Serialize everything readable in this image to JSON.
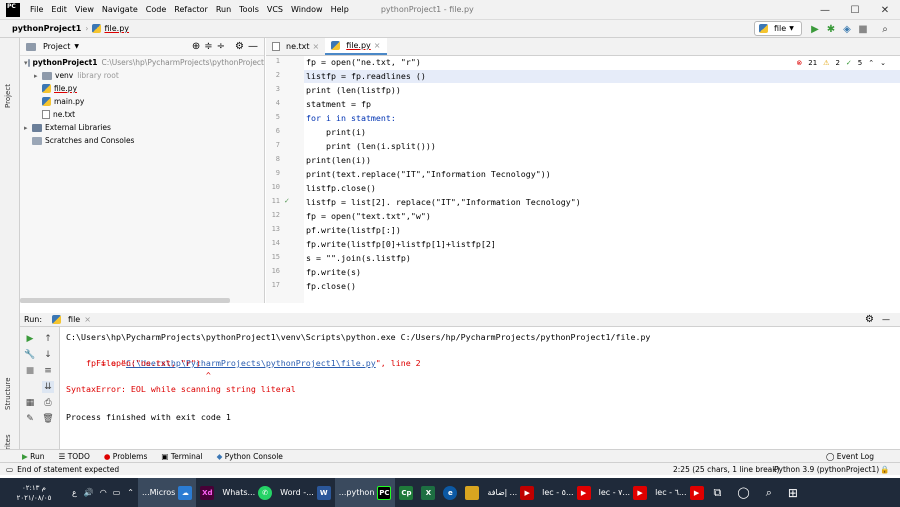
{
  "menubar": {
    "logo": "PC",
    "items": [
      "File",
      "Edit",
      "View",
      "Navigate",
      "Code",
      "Refactor",
      "Run",
      "Tools",
      "VCS",
      "Window",
      "Help"
    ],
    "title": "pythonProject1 - file.py"
  },
  "navbar": {
    "project": "pythonProject1",
    "file": "file.py",
    "run_config": "file"
  },
  "stripe": {
    "project": "Project",
    "structure": "Structure",
    "favorites": "Favorites"
  },
  "project_panel": {
    "title": "Project",
    "root": "pythonProject1",
    "root_path": "C:\\Users\\hp\\PycharmProjects\\pythonProject",
    "venv": "venv",
    "venv_note": "library root",
    "files": [
      "file.py",
      "main.py",
      "ne.txt"
    ],
    "external": "External Libraries",
    "scratches": "Scratches and Consoles"
  },
  "tabs": [
    {
      "label": "ne.txt"
    },
    {
      "label": "file.py"
    }
  ],
  "inspections": {
    "errors": "21",
    "warnings": "2",
    "ok": "5"
  },
  "code_lines": [
    "fp = open(\"ne.txt, \"r\")",
    "listfp = fp.readlines ()",
    "print (len(listfp))",
    "statment = fp",
    "for i in statment:",
    "    print(i)",
    "    print (len(i.split()))",
    "print(len(i))",
    "print(text.replace(\"IT\",\"Information Tecnology\"))",
    "listfp.close()",
    "listfp = list[2]. replace(\"IT\",\"Information Tecnology\")",
    "fp = open(\"text.txt\",\"w\")",
    "pf.write(listfp[:])",
    "fp.write(listfp[0]+listfp[1]+listfp[2]",
    "s = \"\".join(s.listfp)",
    "fp.write(s)",
    "fp.close()"
  ],
  "line_numbers": [
    "1",
    "2",
    "3",
    "4",
    "5",
    "6",
    "7",
    "8",
    "9",
    "10",
    "11",
    "12",
    "13",
    "14",
    "15",
    "16",
    "17"
  ],
  "run": {
    "label": "Run:",
    "config": "file",
    "console": {
      "cmd": "C:\\Users\\hp\\PycharmProjects\\pythonProject1\\venv\\Scripts\\python.exe C:/Users/hp/PycharmProjects/pythonProject1/file.py",
      "file_prefix": "  File \"",
      "file_link": "C:\\Users\\hp\\PycharmProjects\\pythonProject1\\file.py",
      "file_suffix": "\", line 2",
      "code": "    fp = open(\"ne.txt, \"r\")",
      "caret": "                            ^",
      "error": "SyntaxError: EOL while scanning string literal",
      "exit": "Process finished with exit code 1"
    }
  },
  "toolstrip": {
    "run": "Run",
    "todo": "TODO",
    "problems": "Problems",
    "terminal": "Terminal",
    "console": "Python Console",
    "eventlog": "Event Log"
  },
  "status": {
    "left": "End of statement expected",
    "pos": "2:25 (25 chars, 1 line break)",
    "interp": "Python 3.9 (pythonProject1)"
  },
  "taskbar": {
    "clock_time": "م ٠٢:١٣",
    "clock_date": "٢٠٢١/٠٨/٠٥",
    "lang": "ع",
    "apps": [
      {
        "label": "...Micros",
        "color": "#2b7cd3"
      },
      {
        "label": "Xd",
        "color": "#470137"
      },
      {
        "label": "Whats...",
        "color": "#25d366"
      },
      {
        "label": "Word -...",
        "color": "#2b579a"
      },
      {
        "label": "...python",
        "color": "#000000"
      },
      {
        "label": "Cp",
        "color": "#1f7a3a"
      },
      {
        "label": "X",
        "color": "#1d6f42"
      },
      {
        "label": "e",
        "color": "#0c59a4"
      },
      {
        "label": "",
        "color": "#d9a520"
      },
      {
        "label": "إضافة ...",
        "color": "#c00000"
      },
      {
        "label": "lec - ٥...",
        "color": "#e00000"
      },
      {
        "label": "lec - ٧...",
        "color": "#e00000"
      },
      {
        "label": "lec - ٦...",
        "color": "#e00000"
      }
    ]
  }
}
